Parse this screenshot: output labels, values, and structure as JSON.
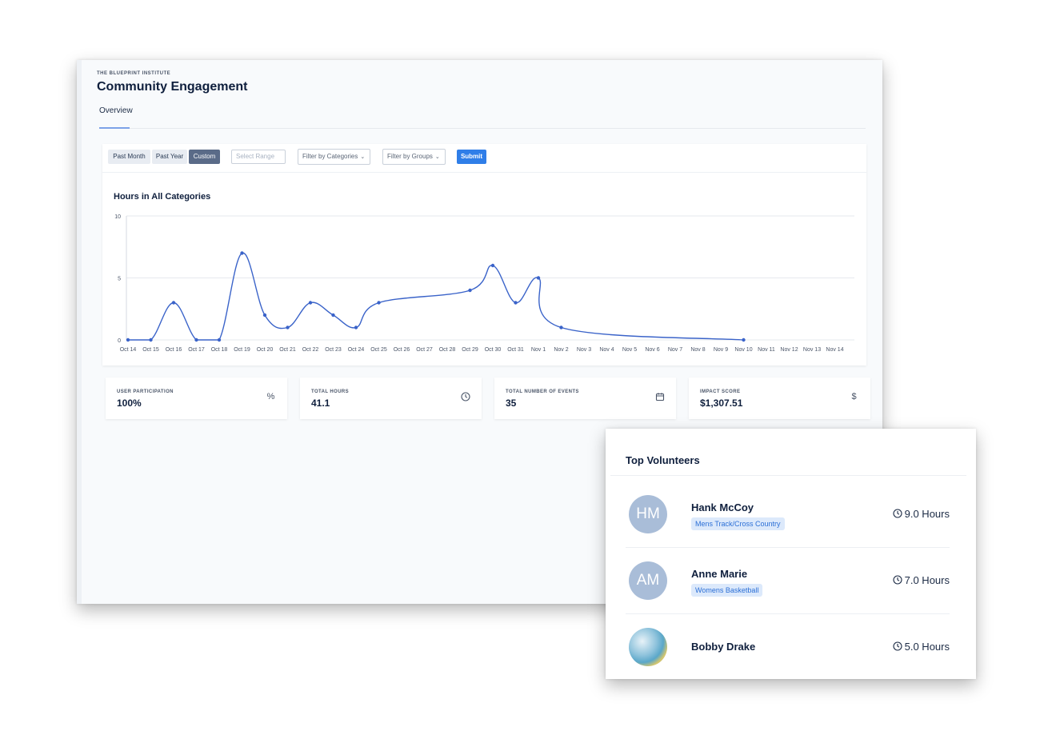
{
  "header": {
    "org_name": "THE BLUEPRINT INSTITUTE",
    "title": "Community Engagement",
    "tabs": [
      {
        "label": "Overview",
        "active": true
      }
    ]
  },
  "filters": {
    "range_buttons": [
      {
        "label": "Past Month",
        "active": false
      },
      {
        "label": "Past Year",
        "active": false
      },
      {
        "label": "Custom",
        "active": true
      }
    ],
    "range_input_placeholder": "Select Range",
    "category_dropdown": "Filter by Categories",
    "group_dropdown": "Filter by Groups",
    "submit_label": "Submit"
  },
  "chart_data": {
    "type": "line",
    "title": "Hours in All Categories",
    "x": [
      "Oct 14",
      "Oct 15",
      "Oct 16",
      "Oct 17",
      "Oct 18",
      "Oct 19",
      "Oct 20",
      "Oct 21",
      "Oct 22",
      "Oct 23",
      "Oct 24",
      "Oct 25",
      "Oct 26",
      "Oct 27",
      "Oct 28",
      "Oct 29",
      "Oct 30",
      "Oct 31",
      "Nov 1",
      "Nov 2",
      "Nov 3",
      "Nov 4",
      "Nov 5",
      "Nov 6",
      "Nov 7",
      "Nov 8",
      "Nov 9",
      "Nov 10",
      "Nov 11",
      "Nov 12",
      "Nov 13",
      "Nov 14"
    ],
    "points": [
      [
        "Oct 14",
        0
      ],
      [
        "Oct 15",
        0
      ],
      [
        "Oct 16",
        3
      ],
      [
        "Oct 17",
        0
      ],
      [
        "Oct 18",
        0
      ],
      [
        "Oct 19",
        7
      ],
      [
        "Oct 20",
        2
      ],
      [
        "Oct 21",
        1
      ],
      [
        "Oct 22",
        3
      ],
      [
        "Oct 23",
        2
      ],
      [
        "Oct 24",
        1
      ],
      [
        "Oct 25",
        3
      ],
      [
        "Oct 29",
        4
      ],
      [
        "Oct 30",
        6
      ],
      [
        "Oct 31",
        3
      ],
      [
        "Nov 1",
        5
      ],
      [
        "Nov 2",
        1
      ],
      [
        "Nov 10",
        0
      ]
    ],
    "yticks": [
      0,
      5,
      10
    ],
    "ylim": [
      0,
      10
    ],
    "xlabel": "",
    "ylabel": "",
    "grid": true,
    "color": "#3a63c9"
  },
  "stats": [
    {
      "label": "USER PARTICIPATION",
      "value": "100%",
      "icon": "percent-icon"
    },
    {
      "label": "TOTAL HOURS",
      "value": "41.1",
      "icon": "clock-icon"
    },
    {
      "label": "TOTAL NUMBER OF EVENTS",
      "value": "35",
      "icon": "calendar-icon"
    },
    {
      "label": "IMPACT SCORE",
      "value": "$1,307.51",
      "icon": "dollar-icon"
    }
  ],
  "volunteers": {
    "title": "Top Volunteers",
    "items": [
      {
        "initials": "HM",
        "name": "Hank McCoy",
        "group": "Mens Track/Cross Country",
        "hours": "9.0 Hours"
      },
      {
        "initials": "AM",
        "name": "Anne Marie",
        "group": "Womens Basketball",
        "hours": "7.0 Hours"
      },
      {
        "initials": "",
        "name": "Bobby Drake",
        "group": "",
        "hours": "5.0 Hours"
      }
    ]
  },
  "colors": {
    "accent": "#2f7ee8",
    "line": "#3a63c9",
    "tag_bg": "#dce9fb",
    "tag_text": "#2b6fd6",
    "avatar": "#a9bdd8"
  }
}
